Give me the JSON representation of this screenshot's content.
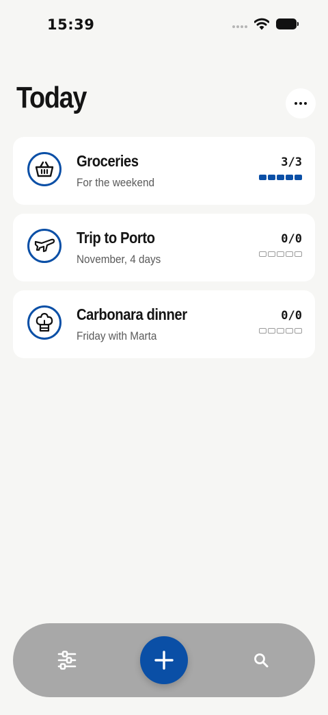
{
  "status_bar": {
    "time": "15:39",
    "icons": [
      "signal-dots-icon",
      "wifi-icon",
      "battery-icon"
    ]
  },
  "header": {
    "title": "Today",
    "more_icon": "ellipsis-icon"
  },
  "lists": [
    {
      "icon": "basket-icon",
      "title": "Groceries",
      "subtitle": "For the weekend",
      "count": "3/3",
      "progress_fraction": 1.0
    },
    {
      "icon": "airplane-icon",
      "title": "Trip to Porto",
      "subtitle": "November, 4 days",
      "count": "0/0",
      "progress_fraction": 0.0
    },
    {
      "icon": "chef-hat-icon",
      "title": "Carbonara dinner",
      "subtitle": "Friday with Marta",
      "count": "0/0",
      "progress_fraction": 0.0
    }
  ],
  "tab_bar": {
    "left_icon": "sliders-icon",
    "center_icon": "plus-icon",
    "right_icon": "search-icon"
  },
  "colors": {
    "accent": "#0a4fa6",
    "background": "#f6f6f4",
    "card": "#ffffff",
    "tab_bar": "#a8a8a8"
  }
}
